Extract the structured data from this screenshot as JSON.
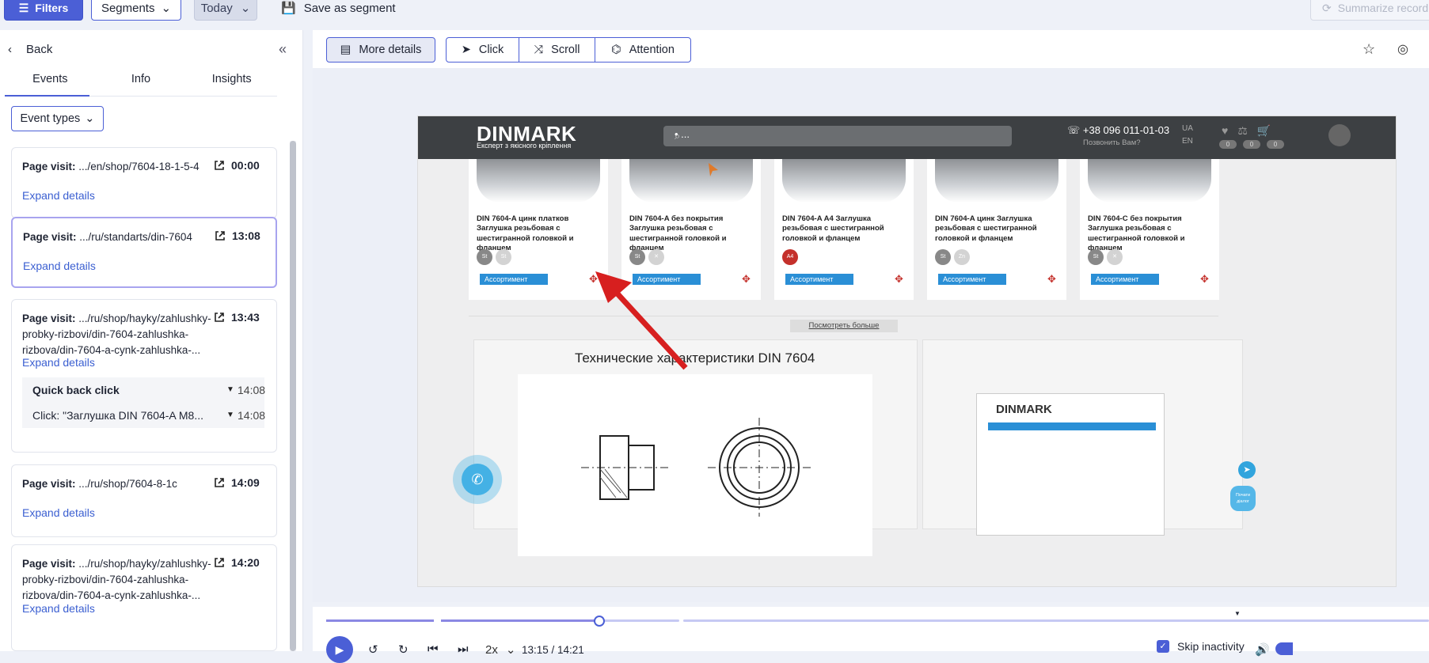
{
  "topbar": {
    "filters_label": "Filters",
    "segments_label": "Segments",
    "date_label": "Today",
    "save_segment_label": "Save as segment",
    "summarize_label": "Summarize record"
  },
  "sidebar": {
    "back_label": "Back",
    "tabs": [
      {
        "label": "Events"
      },
      {
        "label": "Info"
      },
      {
        "label": "Insights"
      }
    ],
    "event_types_label": "Event types",
    "events": [
      {
        "title_prefix": "Page visit:",
        "title": " .../en/shop/7604-18-1-5-4",
        "time": "00:00",
        "expand": "Expand details"
      },
      {
        "title_prefix": "Page visit:",
        "title": " .../ru/standarts/din-7604",
        "time": "13:08",
        "expand": "Expand details"
      },
      {
        "title_prefix": "Page visit:",
        "title": " .../ru/shop/hayky/zahlushky-probky-rizbovi/din-7604-zahlushka-rizbova/din-7604-a-cynk-zahlushka-...",
        "time": "13:43",
        "expand": "Expand details",
        "sub": [
          {
            "label": "Quick back click",
            "time": "14:08"
          },
          {
            "label": "Click: \"Заглушка DIN 7604-A M8...",
            "time": "14:08"
          }
        ]
      },
      {
        "title_prefix": "Page visit:",
        "title": " .../ru/shop/7604-8-1c",
        "time": "14:09",
        "expand": "Expand details"
      },
      {
        "title_prefix": "Page visit:",
        "title": " .../ru/shop/hayky/zahlushky-probky-rizbovi/din-7604-zahlushka-rizbova/din-7604-a-cynk-zahlushka-...",
        "time": "14:20",
        "expand": "Expand details"
      }
    ]
  },
  "toolbar": {
    "more_details_label": "More details",
    "click_label": "Click",
    "scroll_label": "Scroll",
    "attention_label": "Attention"
  },
  "site": {
    "logo": "DINMARK",
    "logo_sub": "Експерт з якісного кріплення",
    "search_text": "• ...",
    "phone": "+38 096 011-01-03",
    "phone_sub": "Позвонить Вам?",
    "lang_ua": "UA",
    "lang_en": "EN",
    "badge_values": [
      "0",
      "0",
      "0"
    ],
    "products": [
      {
        "name": "DIN 7604-A цинк платков Заглушка резьбовая с шестигранной головкой и фланцем",
        "chips": [
          "St",
          "St"
        ],
        "assort": "Ассортимент"
      },
      {
        "name": "DIN 7604-A без покрытия Заглушка резьбовая с шестигранной головкой и фланцем",
        "chips": [
          "St",
          ""
        ],
        "assort": "Ассортимент"
      },
      {
        "name": "DIN 7604-A A4 Заглушка резьбовая с шестигранной головкой и фланцем",
        "chips": [
          "A4"
        ],
        "assort": "Ассортимент"
      },
      {
        "name": "DIN 7604-A цинк Заглушка резьбовая с шестигранной головкой и фланцем",
        "chips": [
          "St",
          "Zn"
        ],
        "assort": "Ассортимент"
      },
      {
        "name": "DIN 7604-C без покрытия Заглушка резьбовая с шестигранной головкой и фланцем",
        "chips": [
          "St",
          ""
        ],
        "assort": "Ассортимент"
      }
    ],
    "more_link": "Посмотреть больше",
    "tech_title": "Технические характеристики DIN 7604",
    "pdf_logo": "DINMARK",
    "chat_label": "Почати діалог"
  },
  "player": {
    "speed": "2x",
    "timecode": "13:15 / 14:21",
    "progress_fraction": 0.923,
    "skip_inactivity_label": "Skip inactivity"
  }
}
